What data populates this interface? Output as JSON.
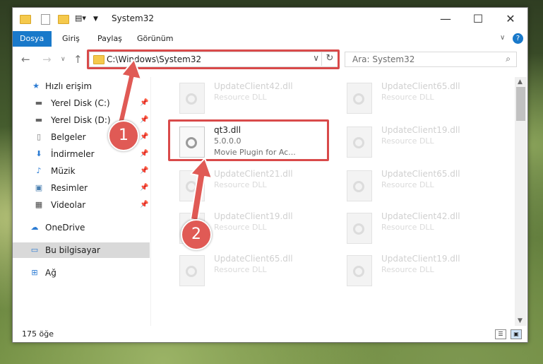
{
  "window": {
    "title": "System32"
  },
  "ribbon": {
    "tabs": [
      "Dosya",
      "Giriş",
      "Paylaş",
      "Görünüm"
    ]
  },
  "address": {
    "path": "C:\\Windows\\System32"
  },
  "search": {
    "placeholder": "Ara: System32"
  },
  "sidebar": {
    "quick_access": "Hızlı erişim",
    "items": [
      "Yerel Disk (C:)",
      "Yerel Disk (D:)",
      "Belgeler",
      "İndirmeler",
      "Müzik",
      "Resimler",
      "Videolar"
    ],
    "onedrive": "OneDrive",
    "this_pc": "Bu bilgisayar",
    "network": "Ağ"
  },
  "files": [
    {
      "name": "UpdateClient42.dll",
      "desc": "Resource DLL"
    },
    {
      "name": "UpdateClient65.dll",
      "desc": "Resource DLL"
    },
    {
      "name": "qt3.dll",
      "desc": "5.0.0.0",
      "desc2": "Movie Plugin for Ac..."
    },
    {
      "name": "UpdateClient19.dll",
      "desc": "Resource DLL"
    },
    {
      "name": "UpdateClient21.dll",
      "desc": "Resource DLL"
    },
    {
      "name": "UpdateClient65.dll",
      "desc": "Resource DLL"
    },
    {
      "name": "UpdateClient19.dll",
      "desc": "Resource DLL"
    },
    {
      "name": "UpdateClient42.dll",
      "desc": "Resource DLL"
    },
    {
      "name": "UpdateClient65.dll",
      "desc": "Resource DLL"
    },
    {
      "name": "UpdateClient19.dll",
      "desc": "Resource DLL"
    }
  ],
  "status": {
    "count": "175 öğe"
  },
  "annotations": {
    "badge1": "1",
    "badge2": "2"
  },
  "colors": {
    "accent": "#1979ca",
    "highlight": "#d94a4a"
  }
}
